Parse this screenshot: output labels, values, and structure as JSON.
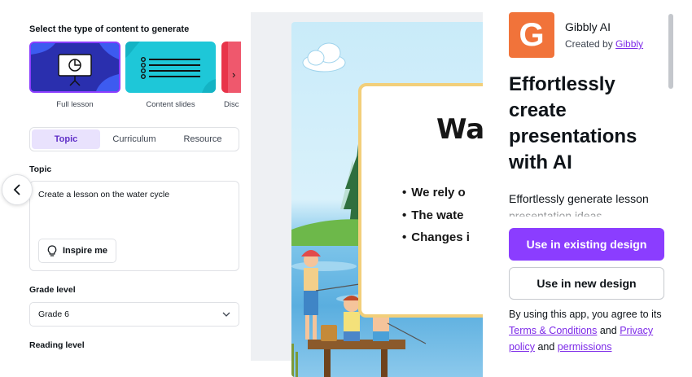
{
  "left": {
    "section_title": "Select the type of content to generate",
    "cards": [
      {
        "label": "Full lesson",
        "icon": "presentation-board-icon"
      },
      {
        "label": "Content slides",
        "icon": "list-lines-icon"
      },
      {
        "label": "Disc",
        "icon": "discussion-icon"
      }
    ],
    "tabs": [
      "Topic",
      "Curriculum",
      "Resource"
    ],
    "active_tab": "Topic",
    "topic_label": "Topic",
    "topic_value": "Create a lesson on the water cycle",
    "inspire_label": "Inspire me",
    "grade_label": "Grade level",
    "grade_value": "Grade 6",
    "reading_label": "Reading level"
  },
  "preview": {
    "title": "Wa",
    "bullets": [
      "We rely o",
      "The wate",
      "Changes i"
    ]
  },
  "right": {
    "logo_letter": "G",
    "app_name": "Gibbly AI",
    "created_by_prefix": "Created by",
    "creator": "Gibbly",
    "headline": "Effortlessly create presentations with AI",
    "description": "Effortlessly generate lesson presentation ideas",
    "use_existing": "Use in existing design",
    "use_new": "Use in new design",
    "terms_prefix": "By using this app, you agree to its",
    "terms_link": "Terms & Conditions",
    "terms_and": "and",
    "privacy_link": "Privacy policy",
    "terms_and2": "and",
    "permissions_link": "permissions"
  },
  "colors": {
    "accent": "#8b3dff",
    "tab_active_bg": "#e9e2fd",
    "logo_bg": "#f1733a",
    "link": "#7d2ae8"
  }
}
